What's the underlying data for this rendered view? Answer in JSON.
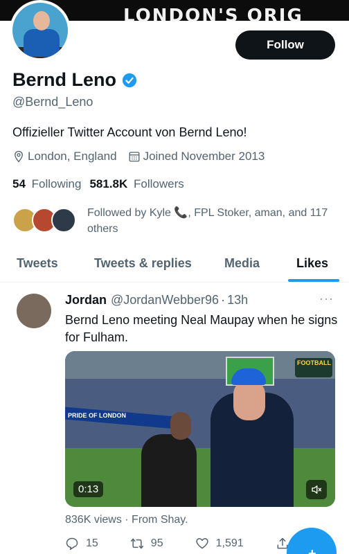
{
  "banner": {
    "text": "LONDON'S ORIG"
  },
  "header": {
    "follow_label": "Follow"
  },
  "profile": {
    "name": "Bernd Leno",
    "handle": "@Bernd_Leno",
    "bio": "Offizieller Twitter Account von Bernd Leno!",
    "location": "London, England",
    "joined": "Joined November 2013",
    "following_count": "54",
    "following_label": "Following",
    "followers_count": "581.8K",
    "followers_label": "Followers",
    "followed_by_text": "Followed by Kyle 📞, FPL Stoker, aman, and 117 others"
  },
  "tabs": [
    {
      "label": "Tweets"
    },
    {
      "label": "Tweets & replies"
    },
    {
      "label": "Media"
    },
    {
      "label": "Likes"
    }
  ],
  "tweet": {
    "author": "Jordan",
    "handle": "@JordanWebber96",
    "separator": "·",
    "time": "13h",
    "more": "···",
    "text": "Bernd Leno meeting Neal Maupay when he signs for Fulham.",
    "video_duration": "0:13",
    "board_text": "PRIDE OF LONDON",
    "logo_text": "FOOTBALL",
    "views_line": "836K views · From Shay.",
    "replies": "15",
    "retweets": "95",
    "likes": "1,591"
  },
  "colors": {
    "accent": "#1d9bf0",
    "text_primary": "#0f1419",
    "text_secondary": "#536471",
    "follow_button_bg": "#0f1419"
  },
  "icons": {
    "verified": "verified-badge-icon",
    "location": "location-pin-icon",
    "calendar": "calendar-icon",
    "reply": "reply-icon",
    "retweet": "retweet-icon",
    "like": "heart-icon",
    "share": "share-icon",
    "mute": "mute-icon",
    "compose": "compose-fab"
  }
}
